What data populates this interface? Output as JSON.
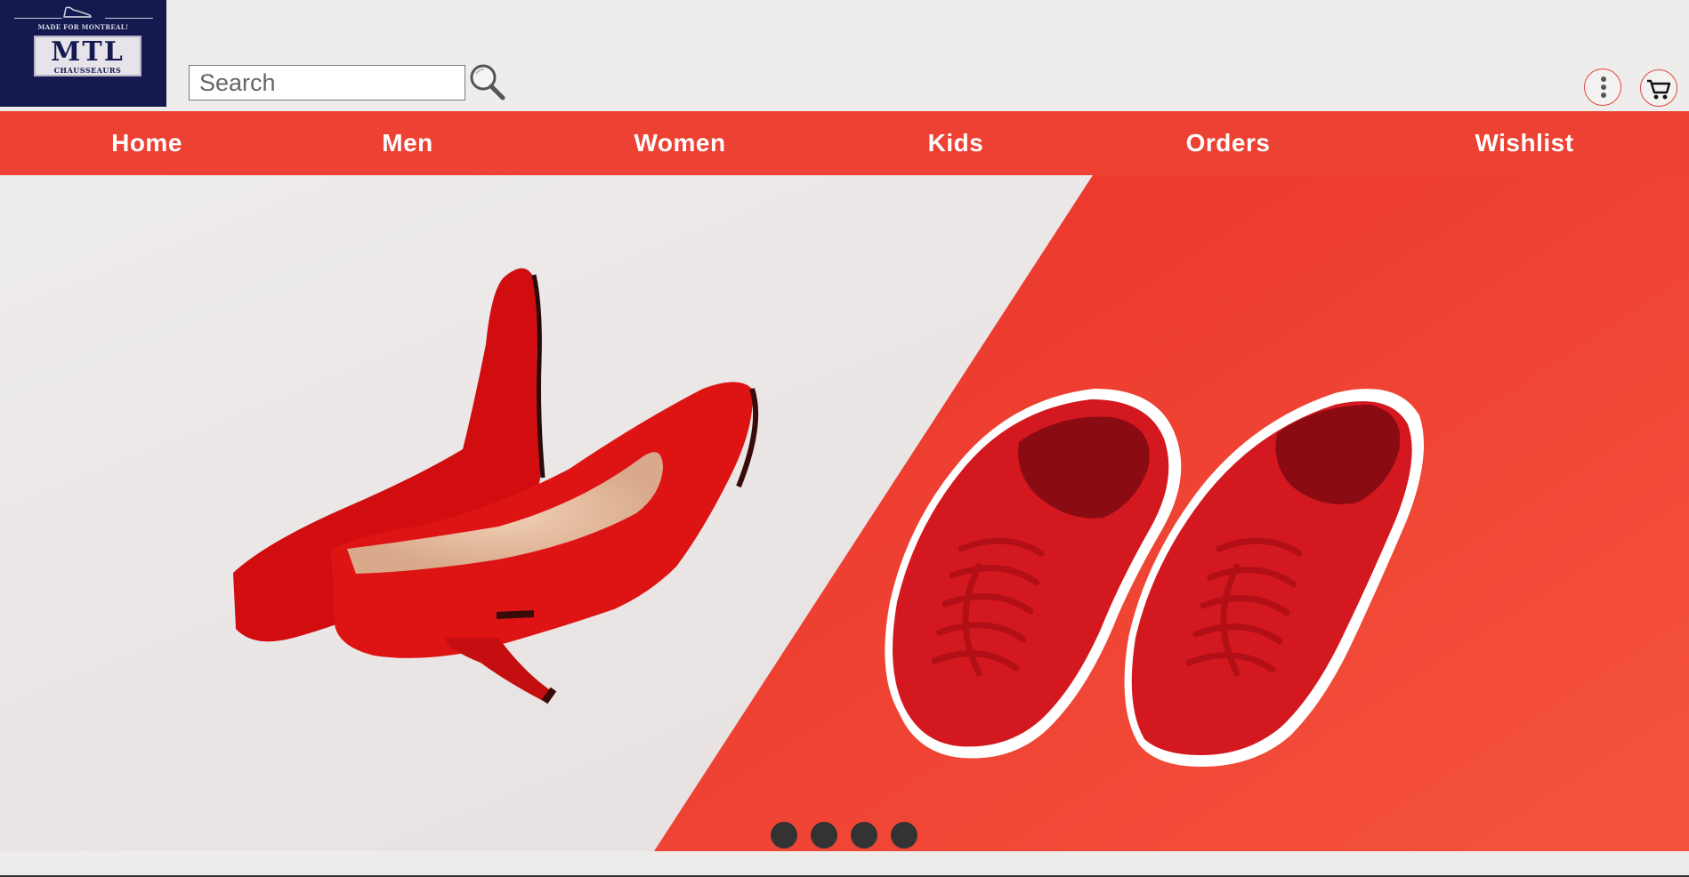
{
  "header": {
    "logo": {
      "tagline": "MADE FOR MONTREAL!",
      "name": "MTL",
      "subname": "CHAUSSEAURS",
      "background_color": "#141a4f"
    },
    "search": {
      "placeholder": "Search",
      "value": "",
      "icon": "magnifier-icon"
    },
    "actions": [
      {
        "name": "more-options",
        "icon": "kebab-menu-icon"
      },
      {
        "name": "cart",
        "icon": "shopping-cart-icon"
      }
    ]
  },
  "nav": {
    "background_color": "#ec4133",
    "items": [
      {
        "label": "Home"
      },
      {
        "label": "Men"
      },
      {
        "label": "Women"
      },
      {
        "label": "Kids"
      },
      {
        "label": "Orders"
      },
      {
        "label": "Wishlist"
      }
    ]
  },
  "hero": {
    "image_description_icon": "red-heels-and-sneakers-image",
    "slide_count": 4,
    "active_slide": 1
  }
}
